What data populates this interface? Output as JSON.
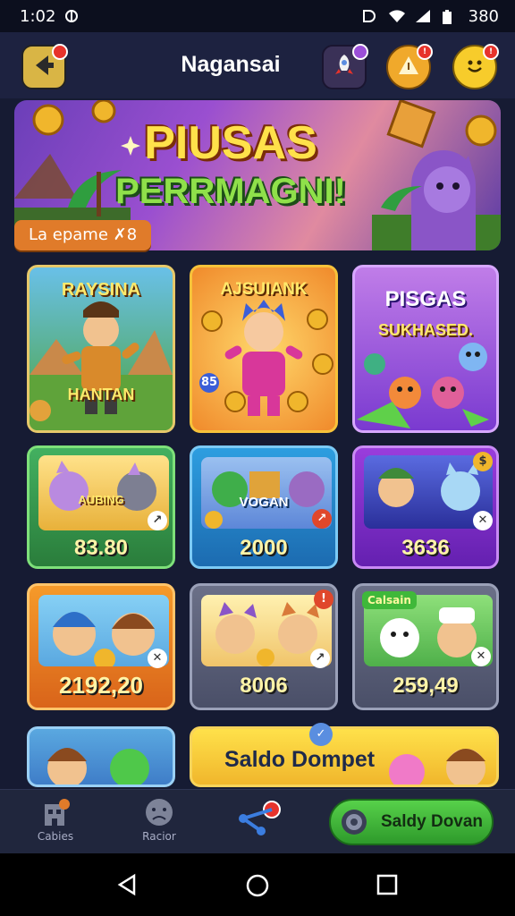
{
  "status_bar": {
    "time": "1:02",
    "battery": "380"
  },
  "header": {
    "title": "Nagansai"
  },
  "banner": {
    "title_line1": "PIUSAS",
    "title_line2": "PERRMAGNI!",
    "tag": "La epame ✗8"
  },
  "games": [
    {
      "label_top": "RAYSINA",
      "label_bottom": "HANTAN"
    },
    {
      "label_top": "AJSUIANK",
      "badge": "85"
    },
    {
      "label_top": "PISGAS",
      "label_mid": "SUKHASED."
    },
    {
      "label_mid": "AUBING",
      "value": "83.80"
    },
    {
      "label_mid": "VOGAN",
      "value": "2000"
    },
    {
      "value": "3636"
    },
    {
      "value": "2192,20"
    },
    {
      "value": "8006"
    },
    {
      "tag": "Calsain",
      "value": "259,49"
    },
    {},
    {
      "label": "Saldo Dompet"
    }
  ],
  "bottom_nav": {
    "item1_label": "Cabies",
    "item2_label": "Racior",
    "cta_label": "Saldy Dovan"
  },
  "colors": {
    "background": "#161b33",
    "accent_orange": "#e07b2a",
    "accent_green": "#3fb83a",
    "gold": "#ffe96b"
  }
}
